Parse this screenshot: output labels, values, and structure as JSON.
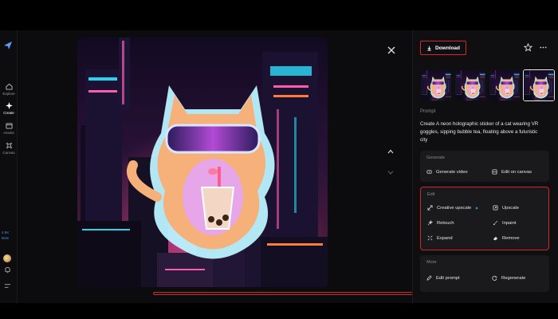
{
  "sidebar": {
    "items": [
      {
        "label": "Explore",
        "icon": "home-icon",
        "active": false
      },
      {
        "label": "Create",
        "icon": "sparkle-icon",
        "active": true
      },
      {
        "label": "Assets",
        "icon": "folder-icon",
        "active": false
      },
      {
        "label": "Canvas",
        "icon": "canvas-icon",
        "active": false
      }
    ],
    "credits": [
      "4.5K",
      "Bots"
    ]
  },
  "panel": {
    "download_label": "Download",
    "prompt_heading": "Prompt",
    "prompt_text": "Create A neon holographic sticker of a cat wearing VR goggles, sipping bubble tea, floating above a futuristic city",
    "generate": {
      "heading": "Generate",
      "actions": [
        "Generate video",
        "Edit on canvas"
      ]
    },
    "edit": {
      "heading": "Edit",
      "actions": [
        "Creative upscale",
        "Upscale",
        "Retouch",
        "Inpaint",
        "Expand",
        "Remove"
      ]
    },
    "more": {
      "heading": "More",
      "actions": [
        "Edit prompt",
        "Regenerate"
      ]
    }
  },
  "colors": {
    "highlight": "#d0262c",
    "accent_blue": "#4b8df0",
    "background": "#0c0c0e"
  }
}
